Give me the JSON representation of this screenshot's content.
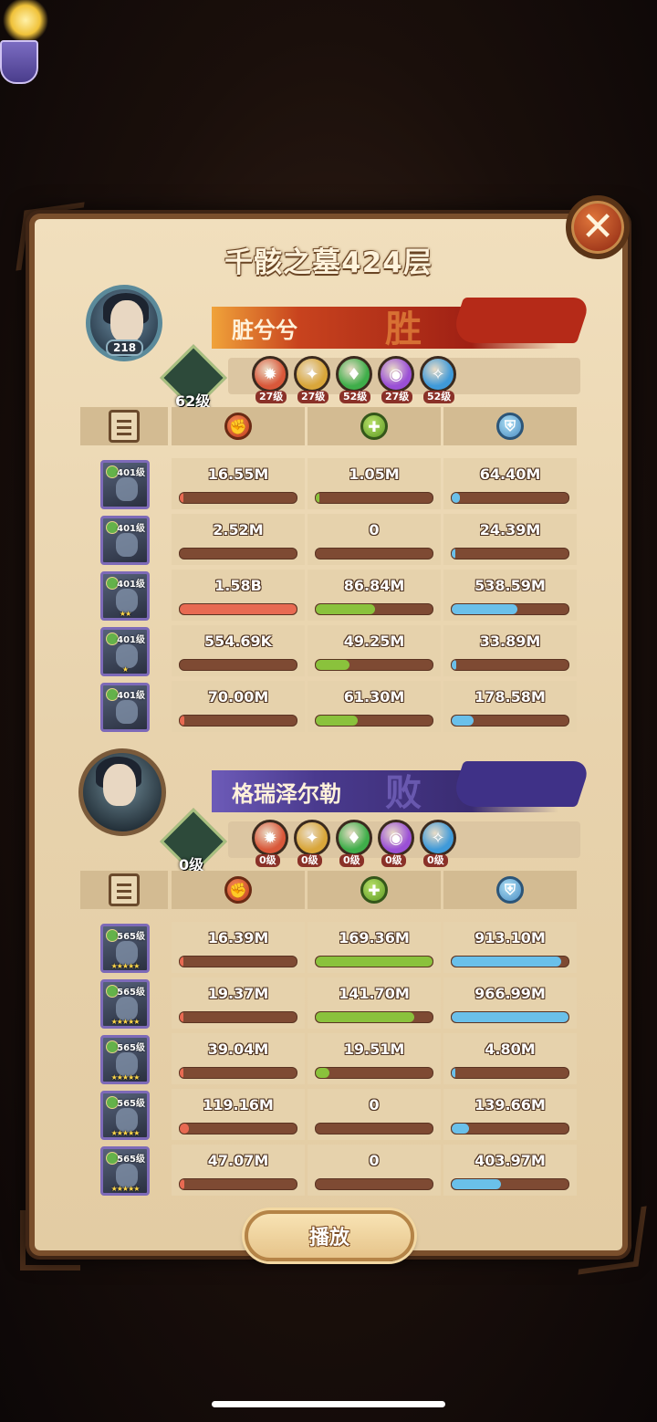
{
  "title": "千骸之墓424层",
  "close_icon": "close-icon",
  "play_label": "播放",
  "colors": {
    "win": "#b52a18",
    "lose": "#4a3a8e",
    "damage": "#e86a52",
    "heal": "#8ac23c",
    "defense": "#6ac0ea"
  },
  "teams": [
    {
      "player_name": "脏兮兮",
      "result": "胜",
      "avatar_level": "218",
      "emblem_level": "62级",
      "factions": [
        {
          "icon": "fire-faction-icon",
          "level": "27级"
        },
        {
          "icon": "light-faction-icon",
          "level": "27级"
        },
        {
          "icon": "nature-faction-icon",
          "level": "52级"
        },
        {
          "icon": "arcane-faction-icon",
          "level": "27级"
        },
        {
          "icon": "water-faction-icon",
          "level": "52级"
        }
      ],
      "heroes": [
        {
          "level": "401级",
          "stars": "",
          "damage": "16.55M",
          "damage_pct": 0.01,
          "healing": "1.05M",
          "healing_pct": 0.01,
          "defense": "64.40M",
          "defense_pct": 0.07
        },
        {
          "level": "401级",
          "stars": "",
          "damage": "2.52M",
          "damage_pct": 0.0,
          "healing": "0",
          "healing_pct": 0.0,
          "defense": "24.39M",
          "defense_pct": 0.03
        },
        {
          "level": "401级",
          "stars": "★★",
          "damage": "1.58B",
          "damage_pct": 1.0,
          "healing": "86.84M",
          "healing_pct": 0.51,
          "defense": "538.59M",
          "defense_pct": 0.56
        },
        {
          "level": "401级",
          "stars": "★",
          "damage": "554.69K",
          "damage_pct": 0.0,
          "healing": "49.25M",
          "healing_pct": 0.29,
          "defense": "33.89M",
          "defense_pct": 0.04
        },
        {
          "level": "401级",
          "stars": "",
          "damage": "70.00M",
          "damage_pct": 0.04,
          "healing": "61.30M",
          "healing_pct": 0.36,
          "defense": "178.58M",
          "defense_pct": 0.19
        }
      ]
    },
    {
      "player_name": "格瑞泽尔勒",
      "result": "败",
      "avatar_level": "",
      "emblem_level": "0级",
      "factions": [
        {
          "icon": "fire-faction-icon",
          "level": "0级"
        },
        {
          "icon": "light-faction-icon",
          "level": "0级"
        },
        {
          "icon": "nature-faction-icon",
          "level": "0级"
        },
        {
          "icon": "arcane-faction-icon",
          "level": "0级"
        },
        {
          "icon": "water-faction-icon",
          "level": "0级"
        }
      ],
      "heroes": [
        {
          "level": "565级",
          "stars": "★★★★★",
          "damage": "16.39M",
          "damage_pct": 0.02,
          "healing": "169.36M",
          "healing_pct": 1.0,
          "defense": "913.10M",
          "defense_pct": 0.94
        },
        {
          "level": "565级",
          "stars": "★★★★★",
          "damage": "19.37M",
          "damage_pct": 0.02,
          "healing": "141.70M",
          "healing_pct": 0.84,
          "defense": "966.99M",
          "defense_pct": 1.0
        },
        {
          "level": "565级",
          "stars": "★★★★★",
          "damage": "39.04M",
          "damage_pct": 0.03,
          "healing": "19.51M",
          "healing_pct": 0.12,
          "defense": "4.80M",
          "defense_pct": 0.01
        },
        {
          "level": "565级",
          "stars": "★★★★★",
          "damage": "119.16M",
          "damage_pct": 0.08,
          "healing": "0",
          "healing_pct": 0.0,
          "defense": "139.66M",
          "defense_pct": 0.15
        },
        {
          "level": "565级",
          "stars": "★★★★★",
          "damage": "47.07M",
          "damage_pct": 0.04,
          "healing": "0",
          "healing_pct": 0.0,
          "defense": "403.97M",
          "defense_pct": 0.42
        }
      ]
    }
  ]
}
